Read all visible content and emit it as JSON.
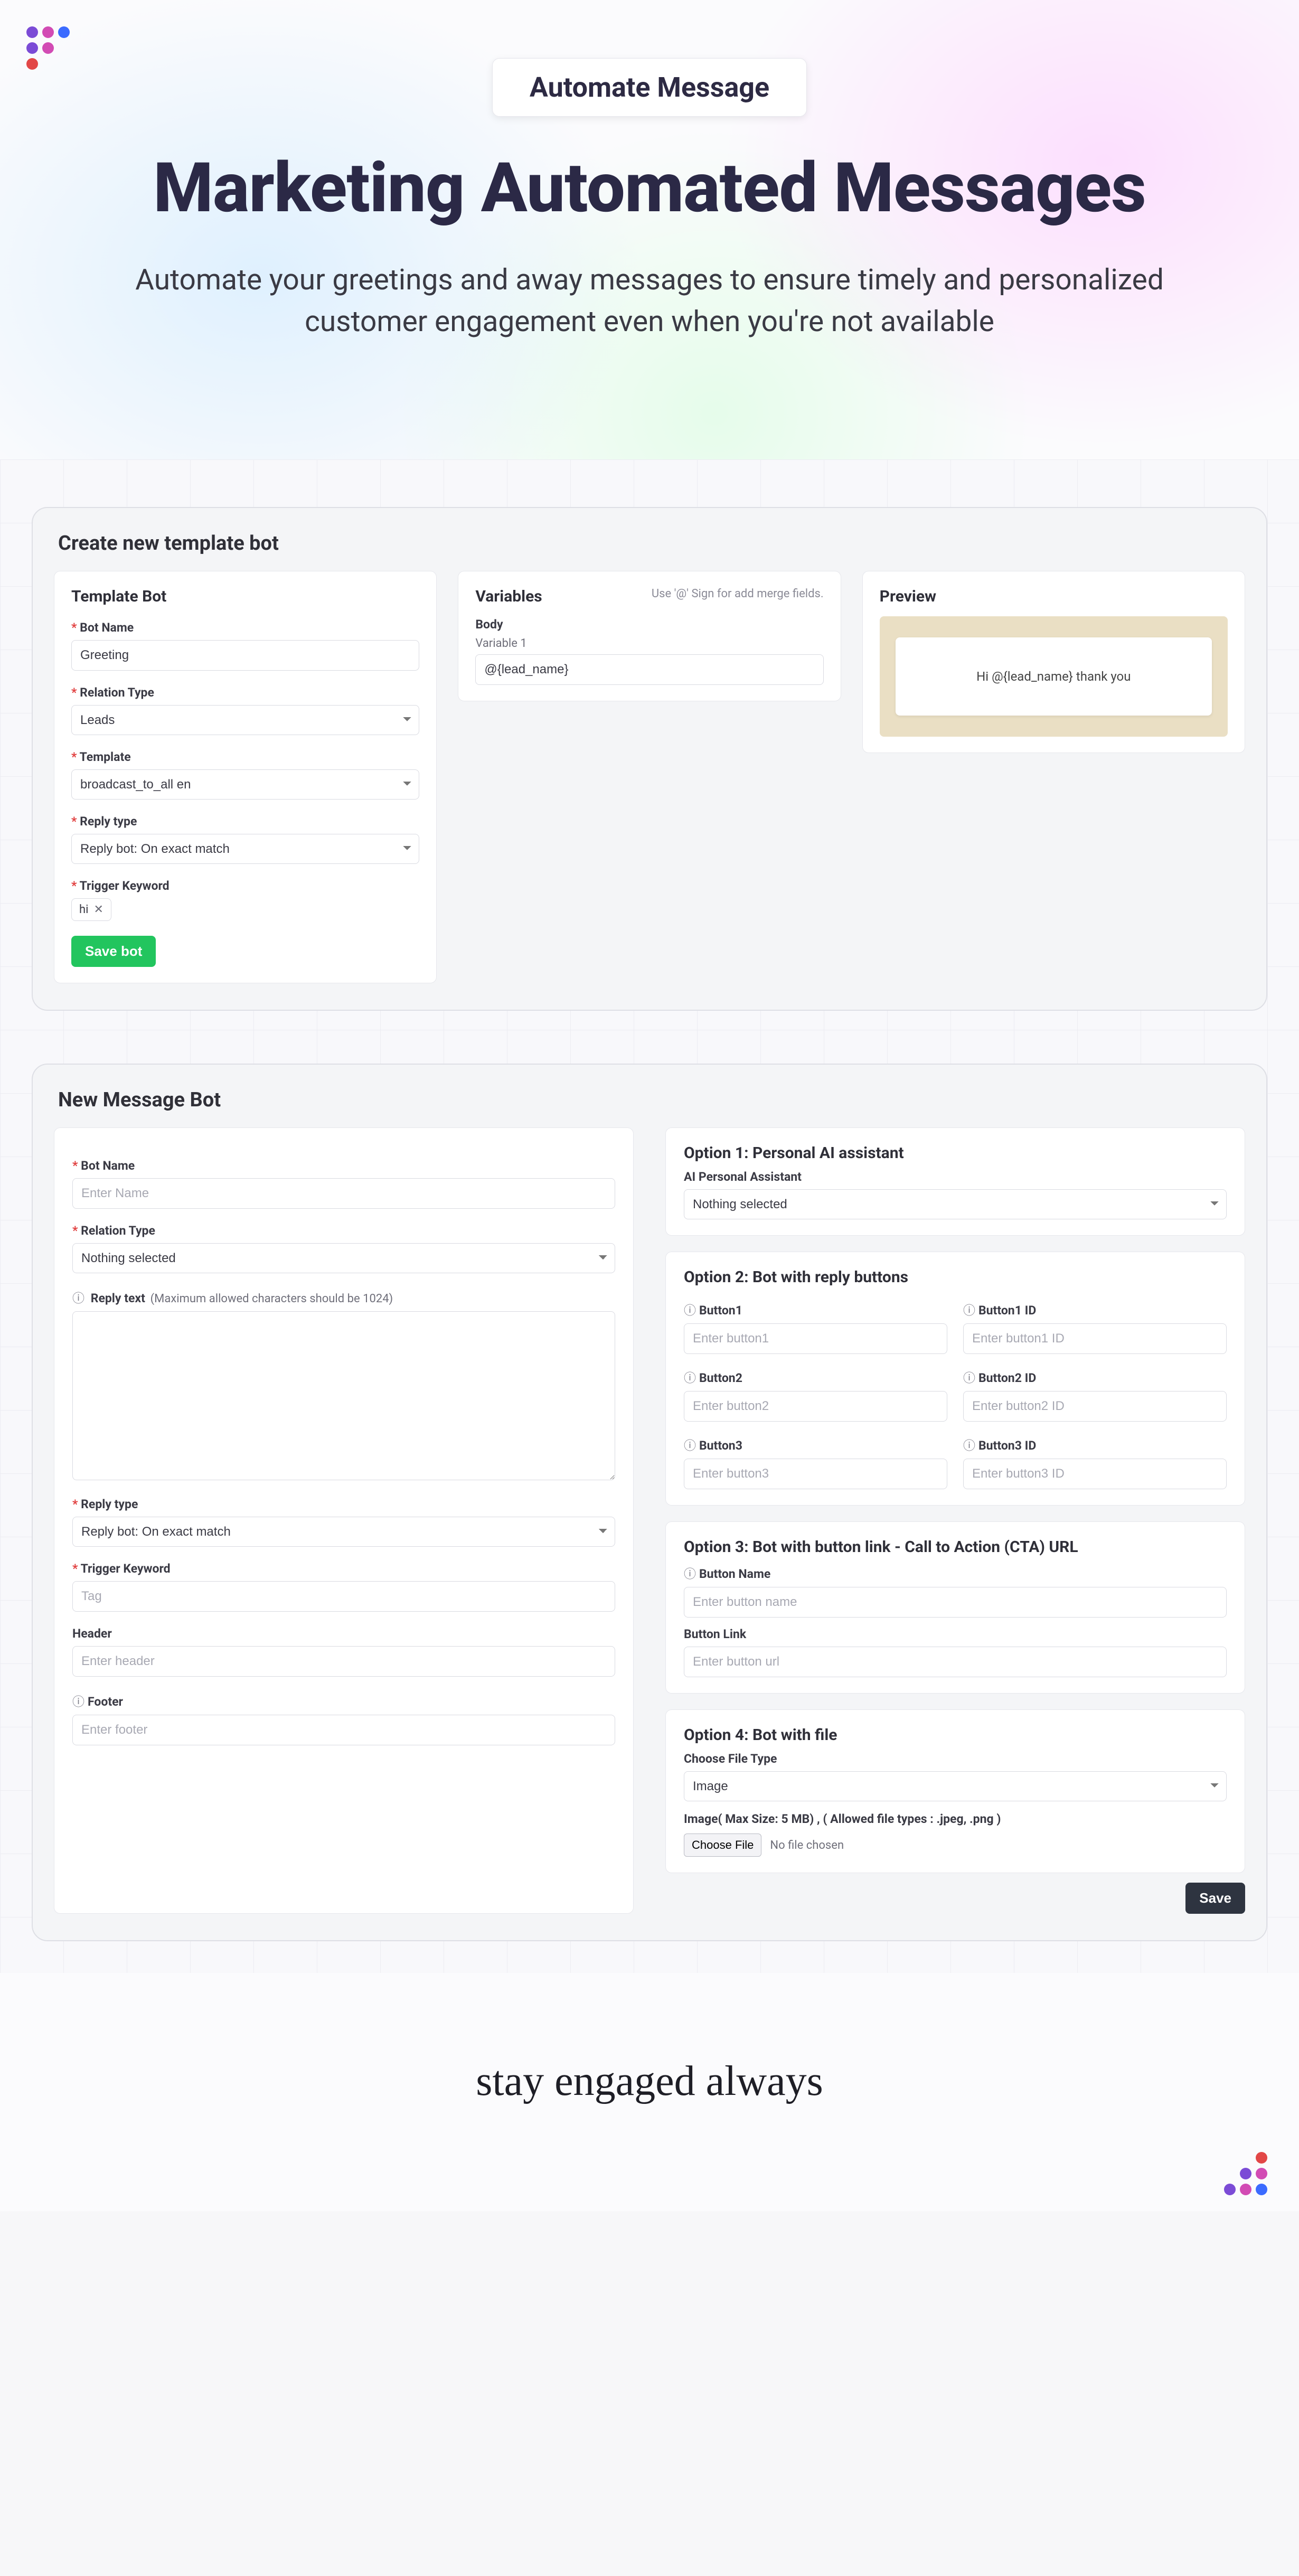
{
  "hero": {
    "pill": "Automate Message",
    "title": "Marketing Automated Messages",
    "subtitle": "Automate your greetings and away messages to ensure timely and personalized customer engagement even when you're not available"
  },
  "panel1": {
    "title": "Create new template bot",
    "templateBot": {
      "heading": "Template Bot",
      "botName_label": "Bot Name",
      "botName_value": "Greeting",
      "relation_label": "Relation Type",
      "relation_value": "Leads",
      "template_label": "Template",
      "template_value": "broadcast_to_all en",
      "replyType_label": "Reply type",
      "replyType_value": "Reply bot: On exact match",
      "trigger_label": "Trigger Keyword",
      "trigger_chip": "hi",
      "save_label": "Save bot"
    },
    "variables": {
      "heading": "Variables",
      "hint": "Use '@' Sign for add merge fields.",
      "body_heading": "Body",
      "var1_label": "Variable 1",
      "var1_value": "@{lead_name}"
    },
    "preview": {
      "heading": "Preview",
      "bubble": "Hi @{lead_name} thank you"
    }
  },
  "panel2": {
    "title": "New Message Bot",
    "left": {
      "botName_label": "Bot Name",
      "botName_ph": "Enter Name",
      "relation_label": "Relation Type",
      "relation_value": "Nothing selected",
      "reply_label": "Reply text",
      "reply_hint": "(Maximum allowed characters should be 1024)",
      "replyType_label": "Reply type",
      "replyType_value": "Reply bot: On exact match",
      "trigger_label": "Trigger Keyword",
      "trigger_ph": "Tag",
      "header_label": "Header",
      "header_ph": "Enter header",
      "footer_label": "Footer",
      "footer_ph": "Enter footer"
    },
    "opt1": {
      "heading": "Option 1: Personal AI assistant",
      "sub": "AI Personal Assistant",
      "value": "Nothing selected"
    },
    "opt2": {
      "heading": "Option 2: Bot with reply buttons",
      "b1": "Button1",
      "b1ph": "Enter button1",
      "b1id": "Button1 ID",
      "b1idph": "Enter button1 ID",
      "b2": "Button2",
      "b2ph": "Enter button2",
      "b2id": "Button2 ID",
      "b2idph": "Enter button2 ID",
      "b3": "Button3",
      "b3ph": "Enter button3",
      "b3id": "Button3 ID",
      "b3idph": "Enter button3 ID"
    },
    "opt3": {
      "heading": "Option 3: Bot with button link - Call to Action (CTA) URL",
      "name_label": "Button Name",
      "name_ph": "Enter button name",
      "link_label": "Button Link",
      "link_ph": "Enter button url"
    },
    "opt4": {
      "heading": "Option 4: Bot with file",
      "type_label": "Choose File Type",
      "type_value": "Image",
      "hint": "Image( Max Size: 5 MB) , ( Allowed file types : .jpeg, .png )",
      "choose": "Choose File",
      "nofile": "No file chosen"
    },
    "save": "Save"
  },
  "footer": {
    "tagline": "stay engaged always"
  }
}
